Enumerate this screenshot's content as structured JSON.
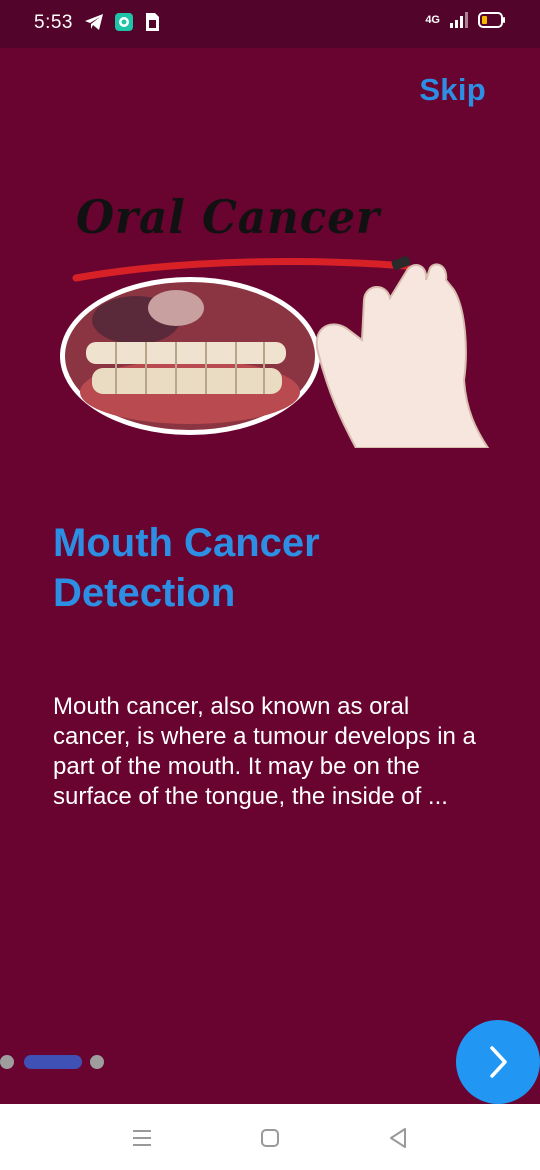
{
  "status_bar": {
    "time": "5:53",
    "network": "4G",
    "icons": [
      "telegram-icon",
      "chat-app-icon",
      "sim-notification-icon",
      "signal-icon",
      "battery-icon"
    ]
  },
  "header": {
    "skip_label": "Skip"
  },
  "hero": {
    "title": "Oral Cancer"
  },
  "content": {
    "title": "Mouth Cancer Detection",
    "description": "Mouth cancer, also known as oral cancer, is where a tumour develops in a part of the mouth. It may be on the surface of the tongue, the inside of ..."
  },
  "pager": {
    "total": 3,
    "current": 2
  },
  "colors": {
    "background": "#690430",
    "status_bar": "#52042a",
    "accent": "#2d8fe3",
    "indicator_active": "#3f51b5",
    "fab": "#2196f3"
  },
  "nav_bar": {
    "buttons": [
      "menu",
      "home",
      "back"
    ]
  }
}
